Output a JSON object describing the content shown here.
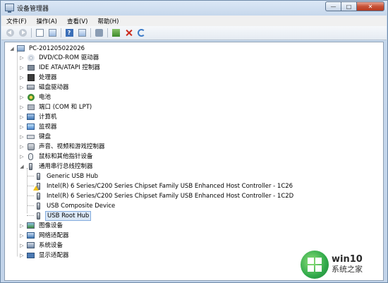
{
  "window": {
    "title": "设备管理器",
    "minimize_glyph": "—",
    "maximize_glyph": "□",
    "close_glyph": "✕"
  },
  "menu": [
    "文件(F)",
    "操作(A)",
    "查看(V)",
    "帮助(H)"
  ],
  "toolbar": {
    "icons": [
      "back-arrow-icon",
      "forward-arrow-icon",
      "properties-icon",
      "list-icon",
      "help-icon",
      "show-hidden-icon",
      "scan-hardware-icon",
      "update-driver-icon",
      "uninstall-icon",
      "disable-icon"
    ]
  },
  "tree": {
    "root": "PC-201205022026",
    "categories": [
      {
        "label": "DVD/CD-ROM 驱动器",
        "icon": "disc-icon"
      },
      {
        "label": "IDE ATA/ATAPI 控制器",
        "icon": "ide-controller-icon"
      },
      {
        "label": "处理器",
        "icon": "processor-icon"
      },
      {
        "label": "磁盘驱动器",
        "icon": "disk-drive-icon"
      },
      {
        "label": "电池",
        "icon": "battery-icon"
      },
      {
        "label": "端口 (COM 和 LPT)",
        "icon": "port-icon"
      },
      {
        "label": "计算机",
        "icon": "computer-icon"
      },
      {
        "label": "监视器",
        "icon": "monitor-icon"
      },
      {
        "label": "键盘",
        "icon": "keyboard-icon"
      },
      {
        "label": "声音、视频和游戏控制器",
        "icon": "sound-icon"
      },
      {
        "label": "鼠标和其他指针设备",
        "icon": "mouse-icon"
      },
      {
        "label": "通用串行总线控制器",
        "icon": "usb-controller-icon",
        "expanded": true
      }
    ],
    "usb_children": [
      {
        "label": "Generic USB Hub",
        "icon": "usb-device-icon",
        "warning": false
      },
      {
        "label": "Intel(R) 6 Series/C200 Series Chipset Family USB Enhanced Host Controller - 1C26",
        "icon": "usb-device-icon",
        "warning": true
      },
      {
        "label": "Intel(R) 6 Series/C200 Series Chipset Family USB Enhanced Host Controller - 1C2D",
        "icon": "usb-device-icon",
        "warning": false
      },
      {
        "label": "USB Composite Device",
        "icon": "usb-device-icon",
        "warning": false
      },
      {
        "label": "USB Root Hub",
        "icon": "usb-device-icon",
        "warning": false,
        "selected": true
      }
    ],
    "after_categories": [
      {
        "label": "图像设备",
        "icon": "imaging-icon"
      },
      {
        "label": "网络适配器",
        "icon": "network-adapter-icon"
      },
      {
        "label": "系统设备",
        "icon": "system-device-icon"
      },
      {
        "label": "显示适配器",
        "icon": "display-adapter-icon"
      }
    ]
  },
  "watermark": {
    "title": "win10",
    "subtitle": "系统之家"
  }
}
